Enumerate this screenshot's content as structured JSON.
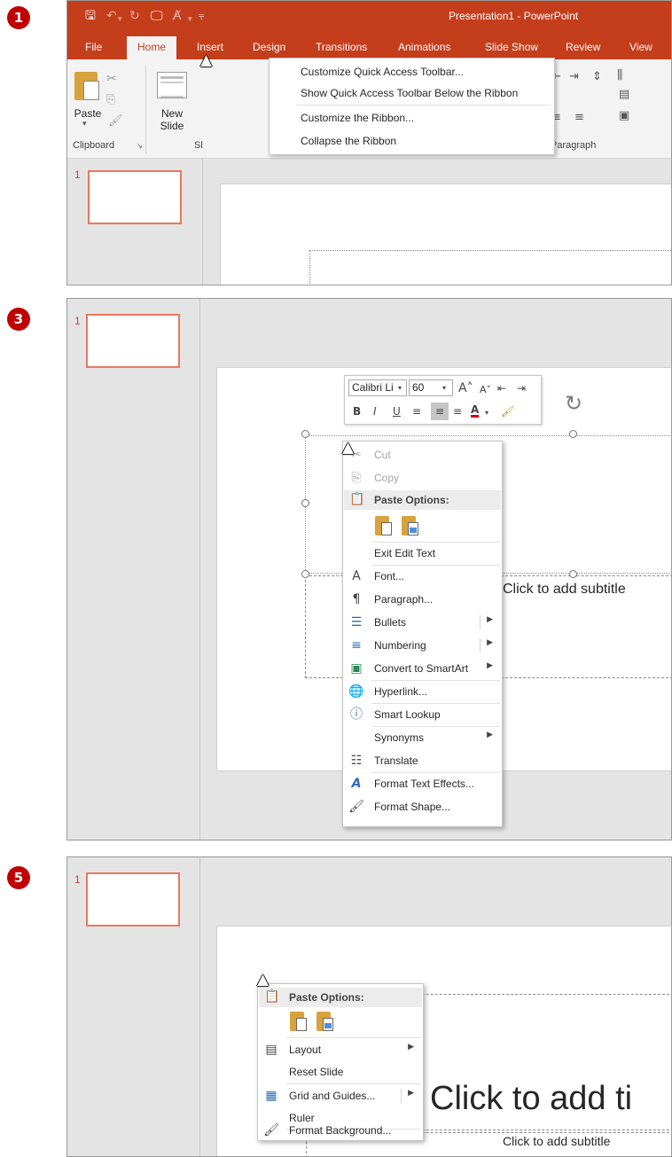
{
  "steps": [
    "1",
    "3",
    "5"
  ],
  "panel1": {
    "window_title": "Presentation1 - PowerPoint",
    "qat": {
      "save_icon": "save-icon",
      "undo_icon": "undo-icon",
      "redo_icon": "redo-icon",
      "presenter_icon": "start-from-beginning-icon",
      "spelling_icon": "spelling-icon",
      "customize_icon": "customize-qat-dropdown-icon"
    },
    "tabs": [
      "File",
      "Home",
      "Insert",
      "Design",
      "Transitions",
      "Animations",
      "Slide Show",
      "Review",
      "View"
    ],
    "active_tab": "Home",
    "ribbon": {
      "paste_label": "Paste",
      "new_slide_label_1": "New",
      "new_slide_label_2": "Slide",
      "clipboard_group": "Clipboard",
      "slides_group_partial": "Sl",
      "paragraph_group": "Paragraph"
    },
    "dropdown": [
      "Customize Quick Access Toolbar...",
      "Show Quick Access Toolbar Below the Ribbon",
      "Customize the Ribbon...",
      "Collapse the Ribbon"
    ],
    "slide_number": "1"
  },
  "panel3": {
    "slide_number": "1",
    "mini_toolbar": {
      "font_name": "Calibri Li",
      "font_size": "60",
      "bold": "B",
      "italic": "I",
      "underline": "U",
      "font_color_letter": "A"
    },
    "subtitle": "Click to add subtitle",
    "menu": {
      "cut": "Cut",
      "copy": "Copy",
      "paste_options": "Paste Options:",
      "exit_edit_text": "Exit Edit Text",
      "font": "Font...",
      "paragraph": "Paragraph...",
      "bullets": "Bullets",
      "numbering": "Numbering",
      "convert_smartart": "Convert to SmartArt",
      "hyperlink": "Hyperlink...",
      "smart_lookup": "Smart Lookup",
      "synonyms": "Synonyms",
      "translate": "Translate",
      "format_text_effects": "Format Text Effects...",
      "format_shape": "Format Shape..."
    }
  },
  "panel5": {
    "slide_number": "1",
    "title_placeholder": "Click to add ti",
    "subtitle": "Click to add subtitle",
    "menu": {
      "paste_options": "Paste Options:",
      "layout": "Layout",
      "reset_slide": "Reset Slide",
      "grid_and_guides": "Grid and Guides...",
      "ruler": "Ruler",
      "format_background": "Format Background..."
    }
  },
  "colors": {
    "powerpoint_accent": "#c43e1c",
    "step_badge": "#c00000",
    "slide_thumb_border": "#e8795e"
  }
}
